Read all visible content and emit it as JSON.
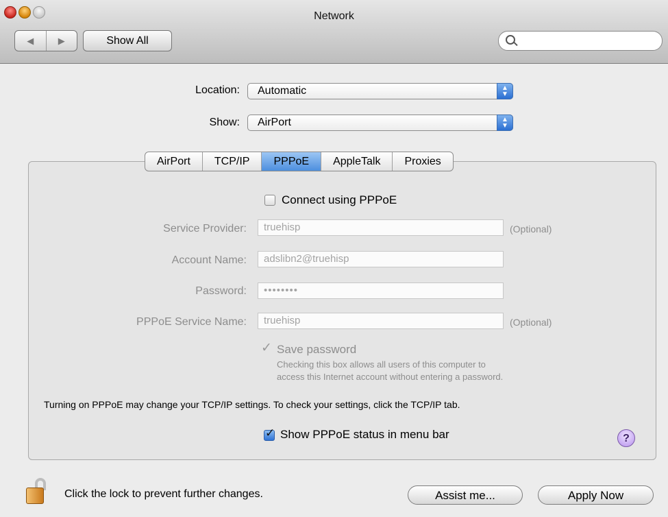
{
  "window": {
    "title": "Network"
  },
  "toolbar": {
    "back_glyph": "◀",
    "forward_glyph": "▶",
    "show_all_label": "Show All",
    "search_value": ""
  },
  "location": {
    "label": "Location:",
    "value": "Automatic"
  },
  "show": {
    "label": "Show:",
    "value": "AirPort"
  },
  "tabs": [
    {
      "label": "AirPort",
      "active": false
    },
    {
      "label": "TCP/IP",
      "active": false
    },
    {
      "label": "PPPoE",
      "active": true
    },
    {
      "label": "AppleTalk",
      "active": false
    },
    {
      "label": "Proxies",
      "active": false
    }
  ],
  "pppoe": {
    "connect_label": "Connect using PPPoE",
    "connect_checked": false,
    "service_provider": {
      "label": "Service Provider:",
      "value": "truehisp",
      "note": "(Optional)"
    },
    "account_name": {
      "label": "Account Name:",
      "value": "adslibn2@truehisp"
    },
    "password": {
      "label": "Password:",
      "value": "••••••••"
    },
    "service_name": {
      "label": "PPPoE Service Name:",
      "value": "truehisp",
      "note": "(Optional)"
    },
    "save_password_label": "Save password",
    "save_password_checked": true,
    "save_hint_line1": "Checking this box allows all users of this computer to",
    "save_hint_line2": "access this Internet account without entering a password.",
    "tcpip_notice": "Turning on PPPoE may change your TCP/IP settings. To check your settings, click the TCP/IP tab.",
    "status_menu_label": "Show PPPoE status in menu bar",
    "status_menu_checked": true,
    "help_label": "?"
  },
  "footer": {
    "lock_text": "Click the lock to prevent further changes.",
    "assist_label": "Assist me...",
    "apply_label": "Apply Now"
  },
  "colors": {
    "accent": "#2f73d6",
    "window_bg": "#ececec"
  },
  "icons": {
    "lock": "lock-open-icon",
    "search": "search-icon",
    "help": "help-icon"
  }
}
